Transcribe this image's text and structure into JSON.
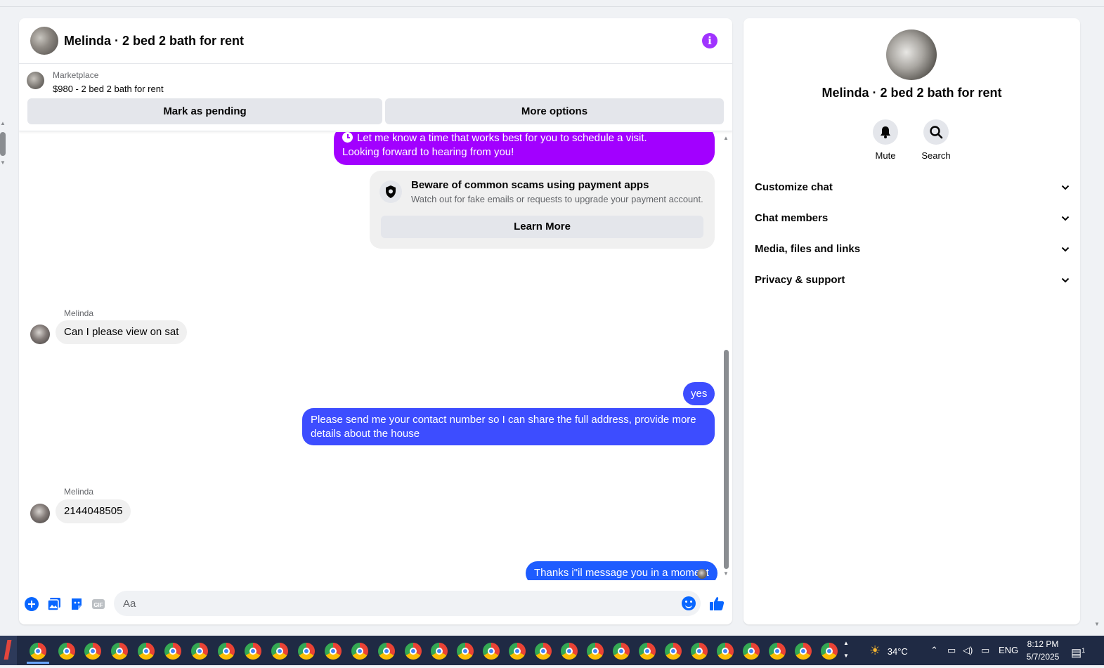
{
  "chat": {
    "title": "Melinda · 2 bed 2 bath for rent",
    "info_icon": "info-icon",
    "marketplace": {
      "label": "Marketplace",
      "listing": "$980 - 2 bed 2 bath for rent",
      "mark_pending": "Mark as pending",
      "more_options": "More options"
    },
    "messages": {
      "purple_line1": "Let me know a time that works best for you to schedule a visit.",
      "purple_line2": "Looking forward to hearing from you!",
      "scam_title": "Beware of common scams using payment apps",
      "scam_desc": "Watch out for fake emails or requests to upgrade your payment account.",
      "learn_more": "Learn More",
      "sender1": "Melinda",
      "msg1": "Can I please view on sat",
      "msg2": "yes",
      "msg3": "Please send me your contact number so I can share the full address, provide more details about the house",
      "sender2": "Melinda",
      "msg4": "2144048505",
      "msg5": "Thanks i\"il message you in a moment"
    },
    "composer": {
      "placeholder": "Aa"
    }
  },
  "side": {
    "name": "Melinda · 2 bed 2 bath for rent",
    "mute": "Mute",
    "search": "Search",
    "rows": [
      "Customize chat",
      "Chat members",
      "Media, files and links",
      "Privacy & support"
    ]
  },
  "taskbar": {
    "temp": "34°C",
    "lang": "ENG",
    "time": "8:12 PM",
    "date": "5/7/2025",
    "notif_count": "1"
  },
  "colors": {
    "accent_purple": "#a200ff",
    "bubble_blue": "#3d4dff",
    "bubble_blue_last": "#1e5cff",
    "fb_blue": "#0866ff"
  }
}
